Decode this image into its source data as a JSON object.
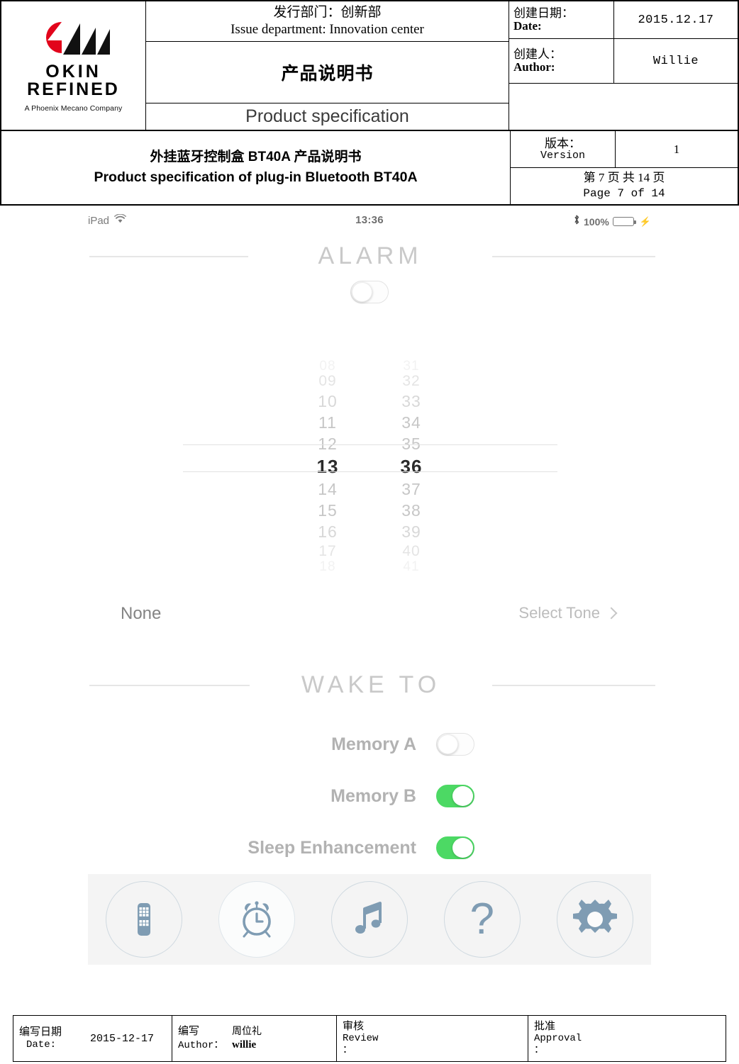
{
  "header": {
    "logo": {
      "brand_line1": "OKIN",
      "brand_line2": "REFINED",
      "tagline": "A Phoenix Mecano Company",
      "mark_red": "#E2041B",
      "mark_black": "#111111"
    },
    "issue_department_cn": "发行部门：创新部",
    "issue_department_en": "Issue department: Innovation center",
    "doc_type_cn": "产品说明书",
    "doc_type_en": "Product specification",
    "date_label_cn": "创建日期：",
    "date_label_en": "Date:",
    "date_value": "2015.12.17",
    "author_label_cn": "创建人：",
    "author_label_en": "Author:",
    "author_value": "Willie",
    "title_cn": "外挂蓝牙控制盒 BT40A 产品说明书",
    "title_en": "Product specification of plug-in Bluetooth BT40A",
    "version_label_cn": "版本：",
    "version_label_en": "Version",
    "version_value": "1",
    "page_cn": "第 7 页 共 14 页",
    "page_en": "Page 7 of 14"
  },
  "screenshot": {
    "statusbar": {
      "device": "iPad",
      "wifi_icon": "wifi-icon",
      "time": "13:36",
      "bluetooth_icon": "bluetooth-icon",
      "battery_percent": "100%",
      "battery_icon": "battery-icon",
      "charging_icon": "lightning-bolt-icon",
      "battery_color": "#4CD964"
    },
    "alarm_section": {
      "title": "ALARM",
      "master_toggle": "off"
    },
    "time_picker": {
      "hours": [
        "08",
        "09",
        "10",
        "11",
        "12",
        "13",
        "14",
        "15",
        "16",
        "17",
        "18"
      ],
      "minutes": [
        "31",
        "32",
        "33",
        "34",
        "35",
        "36",
        "37",
        "38",
        "39",
        "40",
        "41"
      ],
      "selected_hour": "13",
      "selected_minute": "36",
      "selected_index": 5
    },
    "tone_row": {
      "current_tone": "None",
      "action_label": "Select Tone",
      "chevron_icon": "chevron-right-icon"
    },
    "wake_to_section": {
      "title": "WAKE TO",
      "rows": [
        {
          "label": "Memory A",
          "state": "off"
        },
        {
          "label": "Memory B",
          "state": "on"
        },
        {
          "label": "Sleep Enhancement",
          "state": "on"
        }
      ],
      "on_color": "#4CD964"
    },
    "toolbar": {
      "background": "#F4F4F4",
      "icon_color": "#7F9CB3",
      "items": [
        {
          "name": "remote-icon",
          "active": false
        },
        {
          "name": "alarm-clock-icon",
          "active": true
        },
        {
          "name": "music-note-icon",
          "active": false
        },
        {
          "name": "question-mark-icon",
          "active": false
        },
        {
          "name": "gear-icon",
          "active": false
        }
      ]
    }
  },
  "footer": {
    "date_label_cn": "编写日期",
    "date_label_en": "Date:",
    "date_value": "2015-12-17",
    "author_label_cn": "编写",
    "author_label_en": "Author：",
    "author_cn": "周位礼",
    "author_en": "willie",
    "review_label_cn": "审核",
    "review_label_en": "Review",
    "review_colon": "：",
    "review_value": "",
    "approval_label_cn": "批准",
    "approval_label_en": "Approval",
    "approval_colon": "：",
    "approval_value": ""
  }
}
